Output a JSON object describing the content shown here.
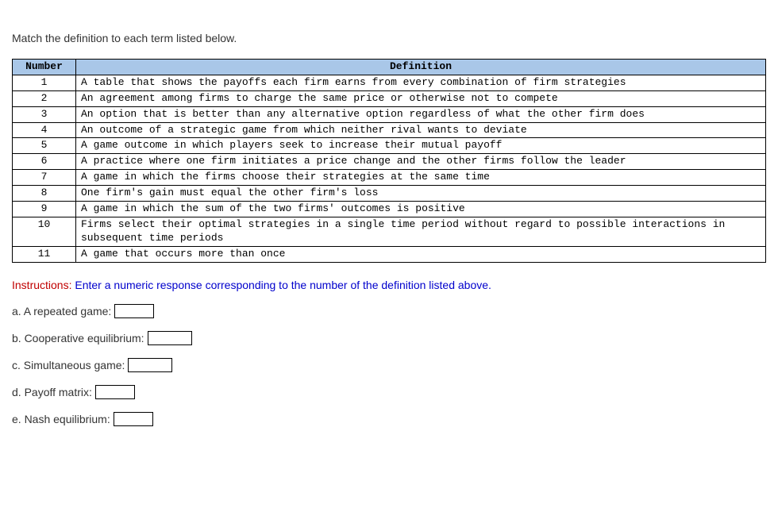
{
  "prompt": "Match the definition to each term listed below.",
  "table": {
    "headers": {
      "number": "Number",
      "definition": "Definition"
    },
    "rows": [
      {
        "num": "1",
        "def": "A table that shows the payoffs each firm earns from every combination of firm strategies"
      },
      {
        "num": "2",
        "def": "An agreement among firms to charge the same price or otherwise not to compete"
      },
      {
        "num": "3",
        "def": "An option that is better than any alternative option regardless of what the other firm does"
      },
      {
        "num": "4",
        "def": "An outcome of a strategic game from which neither rival wants to deviate"
      },
      {
        "num": "5",
        "def": "A game outcome in which players seek to increase their mutual payoff"
      },
      {
        "num": "6",
        "def": "A practice where one firm initiates a price change and the other firms follow the leader"
      },
      {
        "num": "7",
        "def": "A game in which the firms choose their strategies at the same time"
      },
      {
        "num": "8",
        "def": "One firm's gain must equal the other firm's loss"
      },
      {
        "num": "9",
        "def": "A game in which the sum of the two firms' outcomes is positive"
      },
      {
        "num": "10",
        "def": "Firms select their optimal strategies in a single time period without regard to possible interactions in subsequent time periods"
      },
      {
        "num": "11",
        "def": "A game that occurs more than once"
      }
    ]
  },
  "instructions": {
    "label": "Instructions:",
    "text": " Enter a numeric response corresponding to the number of the definition listed above."
  },
  "questions": [
    {
      "label": "a. A repeated game:",
      "value": ""
    },
    {
      "label": "b. Cooperative equilibrium:",
      "value": ""
    },
    {
      "label": "c. Simultaneous game:",
      "value": ""
    },
    {
      "label": "d. Payoff matrix:",
      "value": ""
    },
    {
      "label": "e. Nash equilibrium:",
      "value": ""
    }
  ]
}
